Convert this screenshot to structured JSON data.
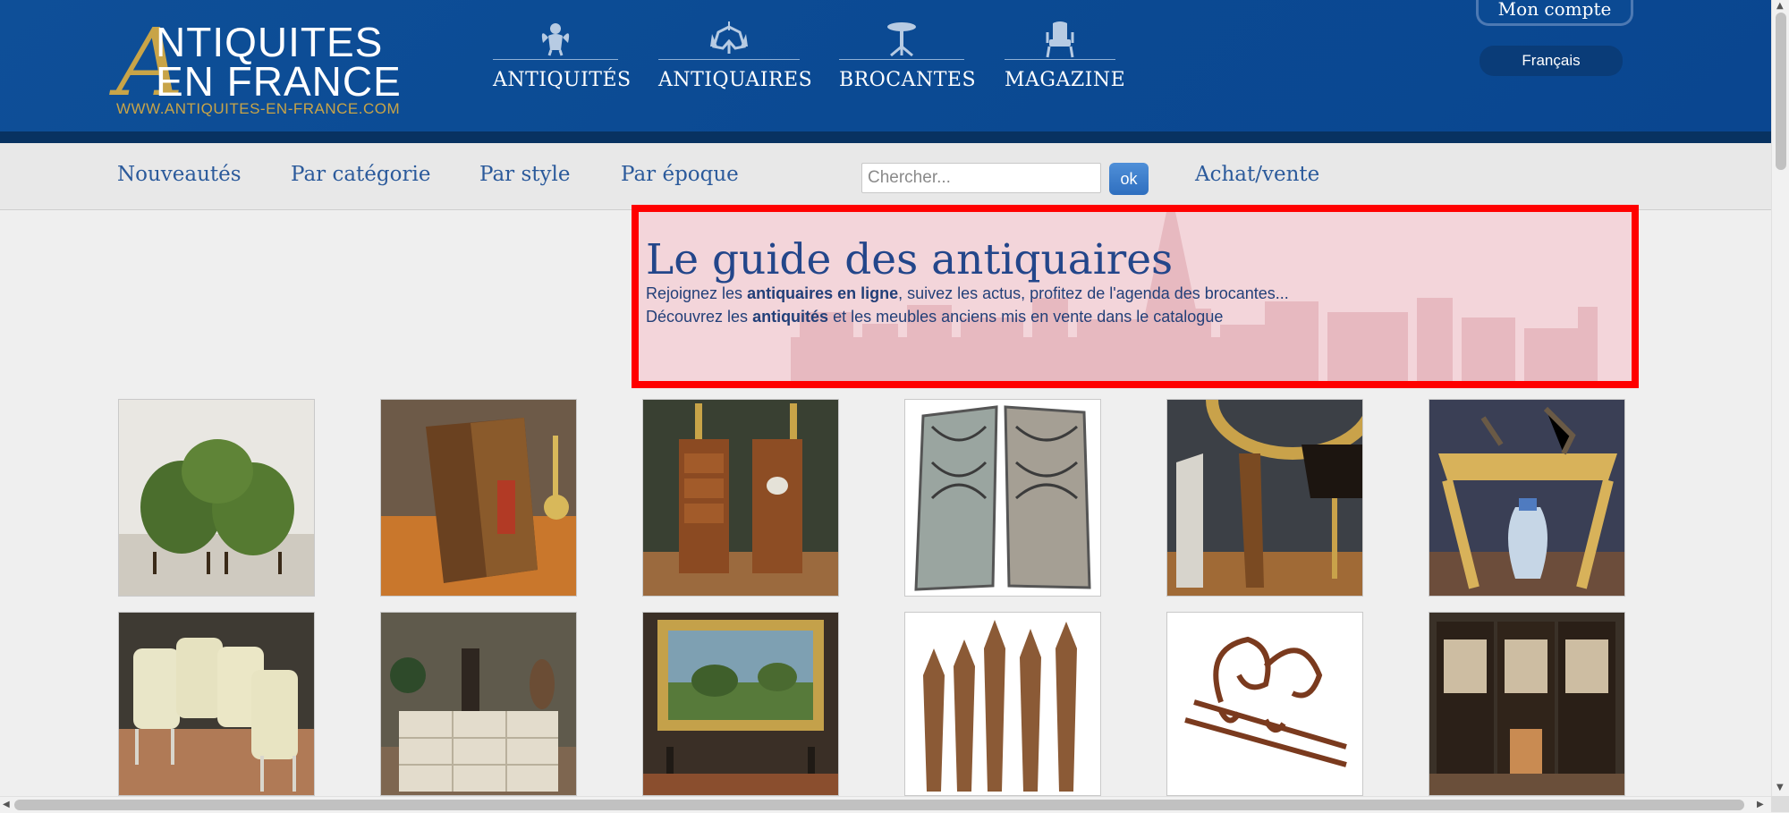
{
  "logo": {
    "initial": "A",
    "line1": "NTIQUITES",
    "line2": "EN FRANCE",
    "url": "WWW.ANTIQUITES-EN-FRANCE.COM"
  },
  "main_nav": [
    {
      "label": "ANTIQUITÉS",
      "icon": "cherub-icon"
    },
    {
      "label": "ANTIQUAIRES",
      "icon": "chandelier-icon"
    },
    {
      "label": "BROCANTES",
      "icon": "gueridon-table-icon"
    },
    {
      "label": "MAGAZINE",
      "icon": "armchair-icon"
    }
  ],
  "account": {
    "label": "Mon compte"
  },
  "language": {
    "label": "Français"
  },
  "subnav": {
    "links": [
      "Nouveautés",
      "Par catégorie",
      "Par style",
      "Par époque"
    ],
    "search_placeholder": "Chercher...",
    "search_button": "ok",
    "buy_sell": "Achat/vente"
  },
  "banner": {
    "title": "Le guide des antiquaires",
    "line1": {
      "pre": "Rejoignez les ",
      "bold": "antiquaires en ligne",
      "post": ", suivez les actus, profitez de l'agenda des brocantes..."
    },
    "line2": {
      "pre": "Découvrez les ",
      "bold": "antiquités",
      "post": " et les meubles anciens mis en vente dans le catalogue"
    }
  },
  "thumbnails": [
    {
      "subject": "green velvet armchairs"
    },
    {
      "subject": "leather book-shaped box"
    },
    {
      "subject": "pair of bedside tables"
    },
    {
      "subject": "wrought iron gates"
    },
    {
      "subject": "gilded mirror and lamp"
    },
    {
      "subject": "console with vase"
    },
    {
      "subject": "set of painted armchairs"
    },
    {
      "subject": "chest of drawers in shop"
    },
    {
      "subject": "framed landscape painting"
    },
    {
      "subject": "carved wooden finials"
    },
    {
      "subject": "wrought iron ornament"
    },
    {
      "subject": "carved folding screen"
    }
  ],
  "colors": {
    "header": "#0b4a93",
    "gold": "#c8a448",
    "link": "#2b5a9b",
    "highlight": "#ff0000"
  }
}
